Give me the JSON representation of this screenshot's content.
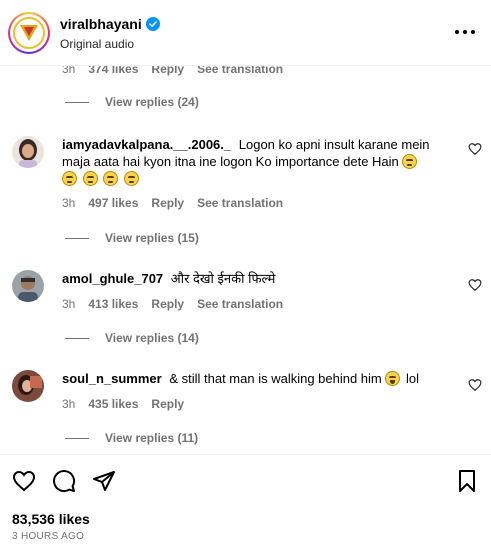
{
  "header": {
    "username": "viralbhayani",
    "subtitle": "Original audio",
    "verified_icon": "verified-badge-icon",
    "more_icon": "more-options-icon"
  },
  "partial_row": {
    "time": "3h",
    "likes": "374 likes",
    "reply": "Reply",
    "see_translation": "See translation"
  },
  "view_replies": [
    "View replies (24)",
    "View replies (15)",
    "View replies (14)",
    "View replies (11)"
  ],
  "comments": [
    {
      "username": "iamyadavkalpana.__.2006._",
      "text": "Logon ko apni insult karane mein maja aata hai kyon itna ine logon Ko importance dete Hain",
      "time": "3h",
      "likes": "497 likes",
      "reply": "Reply",
      "see_translation": "See translation"
    },
    {
      "username": "amol_ghule_707",
      "text": "और देखो ईनकी फिल्मे",
      "time": "3h",
      "likes": "413 likes",
      "reply": "Reply",
      "see_translation": "See translation"
    },
    {
      "username": "soul_n_summer",
      "text": "& still that man is walking behind him",
      "text_after": "lol",
      "time": "3h",
      "likes": "435 likes",
      "reply": "Reply"
    }
  ],
  "footer": {
    "likes": "83,536 likes",
    "time_ago": "3 HOURS AGO"
  },
  "colors": {
    "secondary_text": "#737373",
    "verified": "#0095f6"
  }
}
